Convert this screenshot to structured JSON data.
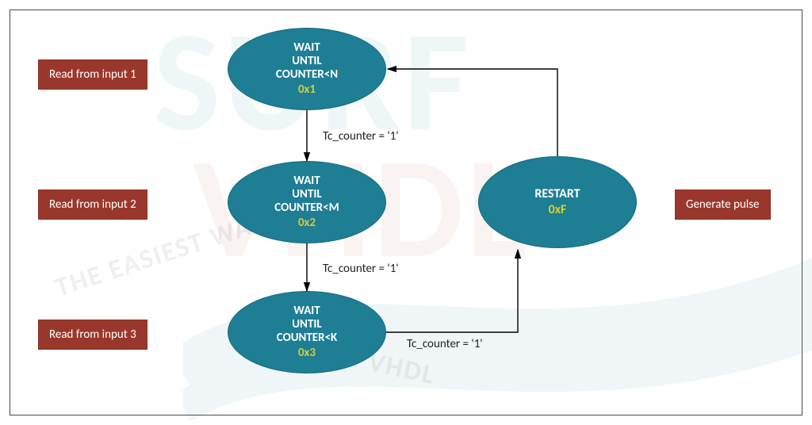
{
  "diagram": {
    "states": {
      "s1": {
        "line1": "WAIT",
        "line2": "UNTIL",
        "line3": "COUNTER<N",
        "code": "0x1"
      },
      "s2": {
        "line1": "WAIT",
        "line2": "UNTIL",
        "line3": "COUNTER<M",
        "code": "0x2"
      },
      "s3": {
        "line1": "WAIT",
        "line2": "UNTIL",
        "line3": "COUNTER<K",
        "code": "0x3"
      },
      "restart": {
        "line1": "RESTART",
        "code": "0xF"
      }
    },
    "labels": {
      "read1": "Read from input 1",
      "read2": "Read from input 2",
      "read3": "Read from input 3",
      "gen": "Generate pulse"
    },
    "edges": {
      "e12": "Tc_counter = '1'",
      "e23": "Tc_counter = '1'",
      "e3r": "Tc_counter = '1'"
    },
    "watermark": {
      "surf": "SURF",
      "vhdl": "VHDL",
      "arc": "THE EASIEST WAY TO",
      "arc2": "LEARN VHDL"
    },
    "colors": {
      "state_fill": "#1d7e94",
      "state_code": "#d6ce3a",
      "rbox_fill": "#9a372c",
      "border": "#4a4a4a"
    }
  }
}
